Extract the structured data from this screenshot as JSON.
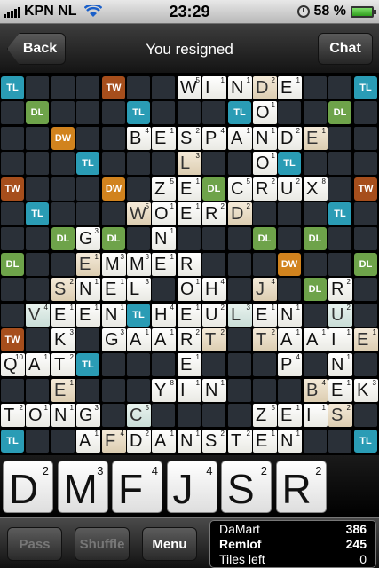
{
  "status": {
    "carrier": "KPN NL",
    "time": "23:29",
    "battery": "58 %"
  },
  "nav": {
    "back": "Back",
    "title": "You resigned",
    "chat": "Chat"
  },
  "colors": {
    "TL": "#2a9cb5",
    "DL": "#6ea34a",
    "TW": "#a64e1c",
    "DW": "#d1831e"
  },
  "board": {
    "bonuses": [
      {
        "r": 0,
        "c": 0,
        "t": "TL"
      },
      {
        "r": 0,
        "c": 4,
        "t": "TW"
      },
      {
        "r": 0,
        "c": 14,
        "t": "TL"
      },
      {
        "r": 1,
        "c": 1,
        "t": "DL"
      },
      {
        "r": 1,
        "c": 5,
        "t": "TL"
      },
      {
        "r": 1,
        "c": 9,
        "t": "TL"
      },
      {
        "r": 1,
        "c": 13,
        "t": "DL"
      },
      {
        "r": 2,
        "c": 2,
        "t": "DW"
      },
      {
        "r": 3,
        "c": 3,
        "t": "TL"
      },
      {
        "r": 3,
        "c": 11,
        "t": "TL"
      },
      {
        "r": 4,
        "c": 0,
        "t": "TW"
      },
      {
        "r": 4,
        "c": 4,
        "t": "DW"
      },
      {
        "r": 4,
        "c": 8,
        "t": "DL"
      },
      {
        "r": 4,
        "c": 14,
        "t": "TW"
      },
      {
        "r": 5,
        "c": 1,
        "t": "TL"
      },
      {
        "r": 5,
        "c": 13,
        "t": "TL"
      },
      {
        "r": 6,
        "c": 2,
        "t": "DL"
      },
      {
        "r": 6,
        "c": 4,
        "t": "DL"
      },
      {
        "r": 6,
        "c": 10,
        "t": "DL"
      },
      {
        "r": 6,
        "c": 12,
        "t": "DL"
      },
      {
        "r": 7,
        "c": 0,
        "t": "DL"
      },
      {
        "r": 7,
        "c": 11,
        "t": "DW"
      },
      {
        "r": 7,
        "c": 14,
        "t": "DL"
      },
      {
        "r": 8,
        "c": 12,
        "t": "DL"
      },
      {
        "r": 9,
        "c": 5,
        "t": "TL"
      },
      {
        "r": 10,
        "c": 0,
        "t": "TW"
      },
      {
        "r": 11,
        "c": 3,
        "t": "TL"
      },
      {
        "r": 14,
        "c": 0,
        "t": "TL"
      },
      {
        "r": 14,
        "c": 14,
        "t": "TL"
      }
    ],
    "tiles": [
      {
        "r": 0,
        "c": 7,
        "l": "W",
        "p": "5"
      },
      {
        "r": 0,
        "c": 8,
        "l": "I",
        "p": "1"
      },
      {
        "r": 0,
        "c": 9,
        "l": "N",
        "p": "1"
      },
      {
        "r": 0,
        "c": 10,
        "l": "D",
        "p": "2",
        "s": "fresh"
      },
      {
        "r": 0,
        "c": 11,
        "l": "E",
        "p": "1"
      },
      {
        "r": 1,
        "c": 10,
        "l": "O",
        "p": "1"
      },
      {
        "r": 2,
        "c": 5,
        "l": "B",
        "p": "4"
      },
      {
        "r": 2,
        "c": 6,
        "l": "E",
        "p": "1"
      },
      {
        "r": 2,
        "c": 7,
        "l": "S",
        "p": "2"
      },
      {
        "r": 2,
        "c": 8,
        "l": "P",
        "p": "4"
      },
      {
        "r": 2,
        "c": 9,
        "l": "A",
        "p": "1"
      },
      {
        "r": 2,
        "c": 10,
        "l": "N",
        "p": "1"
      },
      {
        "r": 2,
        "c": 11,
        "l": "D",
        "p": "2"
      },
      {
        "r": 2,
        "c": 12,
        "l": "E",
        "p": "1",
        "s": "fresh"
      },
      {
        "r": 3,
        "c": 7,
        "l": "L",
        "p": "3",
        "s": "fresh"
      },
      {
        "r": 3,
        "c": 10,
        "l": "O",
        "p": "1"
      },
      {
        "r": 4,
        "c": 6,
        "l": "Z",
        "p": "5"
      },
      {
        "r": 4,
        "c": 7,
        "l": "E",
        "p": "1"
      },
      {
        "r": 4,
        "c": 9,
        "l": "C",
        "p": "5"
      },
      {
        "r": 4,
        "c": 10,
        "l": "R",
        "p": "2"
      },
      {
        "r": 4,
        "c": 11,
        "l": "U",
        "p": "2"
      },
      {
        "r": 4,
        "c": 12,
        "l": "X",
        "p": "8"
      },
      {
        "r": 5,
        "c": 5,
        "l": "W",
        "p": "5",
        "s": "fresh"
      },
      {
        "r": 5,
        "c": 6,
        "l": "O",
        "p": "1"
      },
      {
        "r": 5,
        "c": 7,
        "l": "E",
        "p": "1"
      },
      {
        "r": 5,
        "c": 8,
        "l": "R",
        "p": "2"
      },
      {
        "r": 5,
        "c": 9,
        "l": "D",
        "p": "2",
        "s": "fresh"
      },
      {
        "r": 6,
        "c": 3,
        "l": "G",
        "p": "3"
      },
      {
        "r": 6,
        "c": 6,
        "l": "N",
        "p": "1"
      },
      {
        "r": 7,
        "c": 3,
        "l": "E",
        "p": "1",
        "s": "fresh"
      },
      {
        "r": 7,
        "c": 4,
        "l": "M",
        "p": "3"
      },
      {
        "r": 7,
        "c": 5,
        "l": "M",
        "p": "3"
      },
      {
        "r": 7,
        "c": 6,
        "l": "E",
        "p": "1"
      },
      {
        "r": 7,
        "c": 7,
        "l": "R",
        "p": ""
      },
      {
        "r": 8,
        "c": 2,
        "l": "S",
        "p": "2",
        "s": "fresh"
      },
      {
        "r": 8,
        "c": 3,
        "l": "N",
        "p": "1"
      },
      {
        "r": 8,
        "c": 4,
        "l": "E",
        "p": "1"
      },
      {
        "r": 8,
        "c": 5,
        "l": "L",
        "p": "3"
      },
      {
        "r": 8,
        "c": 7,
        "l": "O",
        "p": "1"
      },
      {
        "r": 8,
        "c": 8,
        "l": "H",
        "p": "4"
      },
      {
        "r": 8,
        "c": 10,
        "l": "J",
        "p": "4",
        "s": "fresh"
      },
      {
        "r": 8,
        "c": 13,
        "l": "R",
        "p": "2"
      },
      {
        "r": 9,
        "c": 1,
        "l": "V",
        "p": "4",
        "s": "teal"
      },
      {
        "r": 9,
        "c": 2,
        "l": "E",
        "p": "1"
      },
      {
        "r": 9,
        "c": 3,
        "l": "E",
        "p": "1"
      },
      {
        "r": 9,
        "c": 4,
        "l": "N",
        "p": "1"
      },
      {
        "r": 9,
        "c": 6,
        "l": "H",
        "p": "4"
      },
      {
        "r": 9,
        "c": 7,
        "l": "E",
        "p": "1"
      },
      {
        "r": 9,
        "c": 8,
        "l": "U",
        "p": "2"
      },
      {
        "r": 9,
        "c": 9,
        "l": "L",
        "p": "3",
        "s": "teal"
      },
      {
        "r": 9,
        "c": 10,
        "l": "E",
        "p": "1"
      },
      {
        "r": 9,
        "c": 11,
        "l": "N",
        "p": "1"
      },
      {
        "r": 9,
        "c": 13,
        "l": "U",
        "p": "2",
        "s": "teal"
      },
      {
        "r": 10,
        "c": 2,
        "l": "K",
        "p": "3"
      },
      {
        "r": 10,
        "c": 4,
        "l": "G",
        "p": "3"
      },
      {
        "r": 10,
        "c": 5,
        "l": "A",
        "p": "1"
      },
      {
        "r": 10,
        "c": 6,
        "l": "A",
        "p": "1"
      },
      {
        "r": 10,
        "c": 7,
        "l": "R",
        "p": "2"
      },
      {
        "r": 10,
        "c": 8,
        "l": "T",
        "p": "2",
        "s": "fresh"
      },
      {
        "r": 10,
        "c": 10,
        "l": "T",
        "p": "2",
        "s": "fresh"
      },
      {
        "r": 10,
        "c": 11,
        "l": "A",
        "p": "1"
      },
      {
        "r": 10,
        "c": 12,
        "l": "A",
        "p": "1"
      },
      {
        "r": 10,
        "c": 13,
        "l": "I",
        "p": "1"
      },
      {
        "r": 10,
        "c": 14,
        "l": "E",
        "p": "1",
        "s": "fresh"
      },
      {
        "r": 11,
        "c": 0,
        "l": "Q",
        "p": "10"
      },
      {
        "r": 11,
        "c": 1,
        "l": "A",
        "p": "1"
      },
      {
        "r": 11,
        "c": 2,
        "l": "T",
        "p": "2"
      },
      {
        "r": 11,
        "c": 7,
        "l": "E",
        "p": "1"
      },
      {
        "r": 11,
        "c": 11,
        "l": "P",
        "p": "4"
      },
      {
        "r": 11,
        "c": 13,
        "l": "N",
        "p": "1"
      },
      {
        "r": 12,
        "c": 2,
        "l": "E",
        "p": "1",
        "s": "fresh"
      },
      {
        "r": 12,
        "c": 6,
        "l": "Y",
        "p": "8"
      },
      {
        "r": 12,
        "c": 7,
        "l": "I",
        "p": "1"
      },
      {
        "r": 12,
        "c": 8,
        "l": "N",
        "p": "1"
      },
      {
        "r": 12,
        "c": 12,
        "l": "B",
        "p": "4",
        "s": "fresh"
      },
      {
        "r": 12,
        "c": 13,
        "l": "E",
        "p": "1"
      },
      {
        "r": 12,
        "c": 14,
        "l": "K",
        "p": "3"
      },
      {
        "r": 13,
        "c": 0,
        "l": "T",
        "p": "2"
      },
      {
        "r": 13,
        "c": 1,
        "l": "O",
        "p": "1"
      },
      {
        "r": 13,
        "c": 2,
        "l": "N",
        "p": "1"
      },
      {
        "r": 13,
        "c": 3,
        "l": "G",
        "p": "3"
      },
      {
        "r": 13,
        "c": 5,
        "l": "C",
        "p": "5",
        "s": "teal"
      },
      {
        "r": 13,
        "c": 10,
        "l": "Z",
        "p": "5"
      },
      {
        "r": 13,
        "c": 11,
        "l": "E",
        "p": "1"
      },
      {
        "r": 13,
        "c": 12,
        "l": "I",
        "p": "1"
      },
      {
        "r": 13,
        "c": 13,
        "l": "S",
        "p": "2",
        "s": "fresh"
      },
      {
        "r": 14,
        "c": 3,
        "l": "A",
        "p": "1"
      },
      {
        "r": 14,
        "c": 4,
        "l": "F",
        "p": "4",
        "s": "fresh"
      },
      {
        "r": 14,
        "c": 5,
        "l": "D",
        "p": "2"
      },
      {
        "r": 14,
        "c": 6,
        "l": "A",
        "p": "1"
      },
      {
        "r": 14,
        "c": 7,
        "l": "N",
        "p": "1"
      },
      {
        "r": 14,
        "c": 8,
        "l": "S",
        "p": "2"
      },
      {
        "r": 14,
        "c": 9,
        "l": "T",
        "p": "2"
      },
      {
        "r": 14,
        "c": 10,
        "l": "E",
        "p": "1"
      },
      {
        "r": 14,
        "c": 11,
        "l": "N",
        "p": "1"
      }
    ]
  },
  "rack": [
    {
      "l": "D",
      "p": "2"
    },
    {
      "l": "M",
      "p": "3"
    },
    {
      "l": "F",
      "p": "4"
    },
    {
      "l": "J",
      "p": "4"
    },
    {
      "l": "S",
      "p": "2"
    },
    {
      "l": "R",
      "p": "2"
    }
  ],
  "toolbar": {
    "pass": "Pass",
    "shuffle": "Shuffle",
    "menu": "Menu"
  },
  "scores": {
    "p1_name": "DaMart",
    "p1_score": "386",
    "p2_name": "Remlof",
    "p2_score": "245",
    "tiles_label": "Tiles left",
    "tiles_left": "0"
  }
}
